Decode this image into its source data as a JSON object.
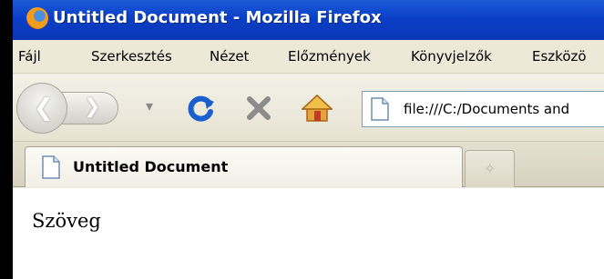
{
  "window": {
    "title": "Untitled Document - Mozilla Firefox"
  },
  "menu": {
    "items": [
      "Fájl",
      "Szerkesztés",
      "Nézet",
      "Előzmények",
      "Könyvjelzők",
      "Eszközö"
    ]
  },
  "navigation": {
    "url": "file:///C:/Documents and",
    "back_icon": "back-arrow-icon",
    "forward_icon": "forward-arrow-icon",
    "reload_icon": "reload-icon",
    "stop_icon": "stop-icon",
    "home_icon": "home-icon"
  },
  "tabs": [
    {
      "title": "Untitled Document",
      "active": true
    }
  ],
  "page": {
    "body_text": "Szöveg"
  },
  "colors": {
    "titlebar": "#0b3fc8",
    "chrome": "#ece9d8",
    "reload": "#1a5fd0",
    "stop": "#8c8c8c"
  }
}
